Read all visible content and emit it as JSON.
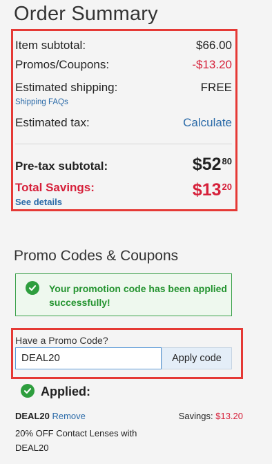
{
  "summary": {
    "title": "Order Summary",
    "item_subtotal_label": "Item subtotal:",
    "item_subtotal_value": "$66.00",
    "promos_label": "Promos/Coupons:",
    "promos_value": "-$13.20",
    "shipping_label": "Estimated shipping:",
    "shipping_value": "FREE",
    "shipping_faq_link": "Shipping FAQs",
    "tax_label": "Estimated tax:",
    "tax_link": "Calculate",
    "pretax_label": "Pre-tax subtotal:",
    "pretax_dollars": "$52",
    "pretax_cents": "80",
    "savings_label": "Total Savings:",
    "savings_dollars": "$13",
    "savings_cents": "20",
    "see_details_link": "See details"
  },
  "promo": {
    "title": "Promo Codes & Coupons",
    "success_message": "Your promotion code has been applied successfully!",
    "input_label": "Have a Promo Code?",
    "input_value": "DEAL20",
    "apply_button": "Apply code",
    "applied_heading": "Applied:",
    "applied_code": "DEAL20",
    "remove_link": "Remove",
    "savings_label": "Savings:",
    "savings_value": "$13.20",
    "description": "20% OFF Contact Lenses with DEAL20"
  },
  "colors": {
    "red": "#d6203a",
    "link_blue": "#2a6aa8",
    "success_green": "#23932f",
    "highlight_border": "#e53935"
  },
  "icons": [
    "check-circle-icon"
  ]
}
